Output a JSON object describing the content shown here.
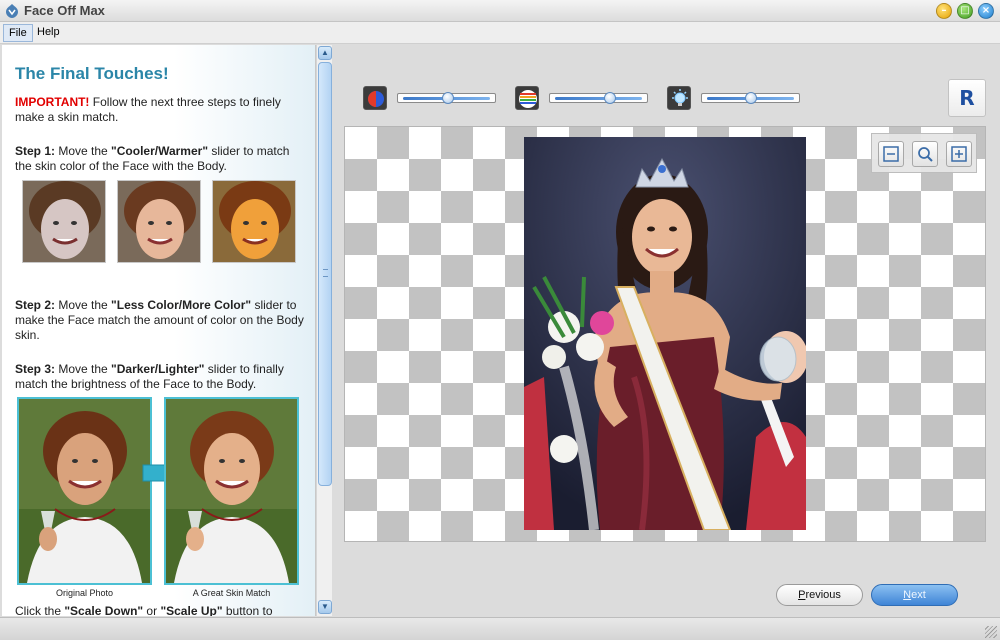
{
  "window": {
    "title": "Face Off Max"
  },
  "menu": {
    "file": "File",
    "help": "Help"
  },
  "instructions": {
    "heading": "The Final Touches!",
    "important_label": "IMPORTANT!",
    "important_text": " Follow the next three steps to finely make a skin match.",
    "step1_label": "Step 1:",
    "step1_pre": " Move the ",
    "step1_slider": "\"Cooler/Warmer\"",
    "step1_post": " slider to match the skin color of the Face with the Body.",
    "step2_label": "Step 2:",
    "step2_pre": " Move the ",
    "step2_slider": "\"Less Color/More Color\"",
    "step2_post": " slider to make the Face match the amount of color on the Body skin.",
    "step3_label": "Step 3:",
    "step3_pre": " Move the ",
    "step3_slider": "\"Darker/Lighter\"",
    "step3_post": " slider to finally match the brightness of the Face to the Body.",
    "caption_original": "Original Photo",
    "caption_match": "A Great Skin Match",
    "scale_pre": "Click the ",
    "scale_down": "\"Scale Down\"",
    "scale_mid": " or ",
    "scale_up": "\"Scale Up\"",
    "scale_post": " button to"
  },
  "toolbar": {
    "sliders": [
      {
        "icon": "cooler-warmer-icon",
        "value": 0.52
      },
      {
        "icon": "color-saturation-icon",
        "value": 0.64
      },
      {
        "icon": "brightness-bulb-icon",
        "value": 0.5
      }
    ],
    "r_button": "R"
  },
  "navigation": {
    "previous_prefix": "P",
    "previous_rest": "revious",
    "next_prefix": "N",
    "next_rest": "ext"
  },
  "colors": {
    "accent": "#2b86a8",
    "important": "#e10000",
    "next_button": "#3f84d6",
    "checker": "#c2c2c2"
  }
}
